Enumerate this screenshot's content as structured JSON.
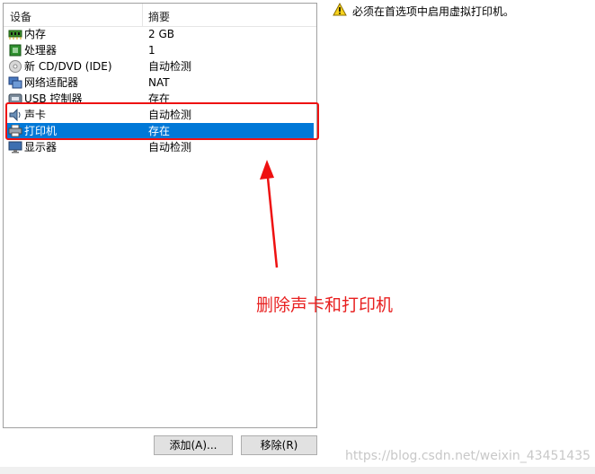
{
  "device_list": {
    "col_device": "设备",
    "col_summary": "摘要",
    "rows": [
      {
        "name": "内存",
        "summary": "2 GB",
        "icon": "memory-icon"
      },
      {
        "name": "处理器",
        "summary": "1",
        "icon": "processor-icon"
      },
      {
        "name": "新 CD/DVD (IDE)",
        "summary": "自动检测",
        "icon": "cd-dvd-icon"
      },
      {
        "name": "网络适配器",
        "summary": "NAT",
        "icon": "network-adapter-icon"
      },
      {
        "name": "USB 控制器",
        "summary": "存在",
        "icon": "usb-controller-icon"
      },
      {
        "name": "声卡",
        "summary": "自动检测",
        "icon": "sound-card-icon"
      },
      {
        "name": "打印机",
        "summary": "存在",
        "icon": "printer-icon",
        "selected": true
      },
      {
        "name": "显示器",
        "summary": "自动检测",
        "icon": "display-icon"
      }
    ]
  },
  "buttons": {
    "add": "添加(A)...",
    "remove": "移除(R)"
  },
  "warning": {
    "text": "必须在首选项中启用虚拟打印机。",
    "icon": "warning-icon"
  },
  "annotation": {
    "text": "删除声卡和打印机",
    "color": "#e82020"
  },
  "watermark": "https://blog.csdn.net/weixin_43451435",
  "colors": {
    "selection": "#0078d7",
    "highlight": "#ee1111"
  }
}
